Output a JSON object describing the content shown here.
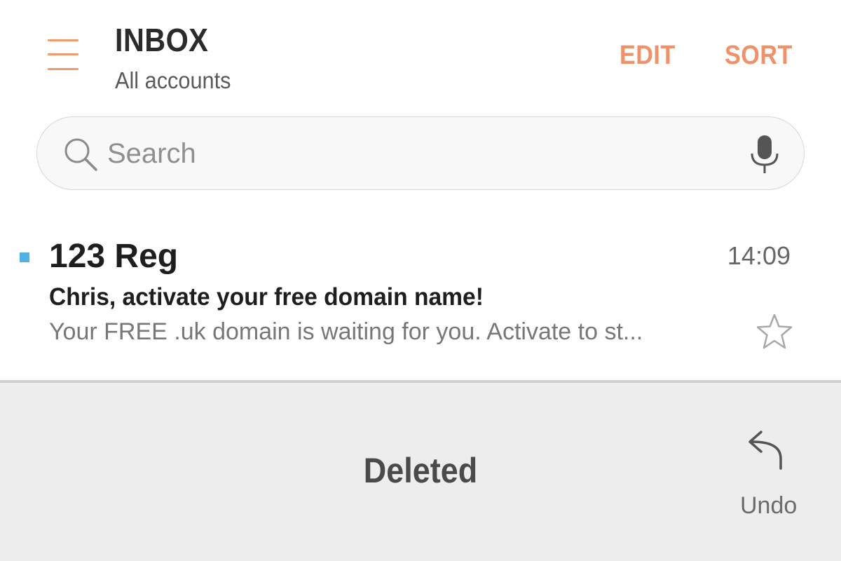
{
  "header": {
    "title": "INBOX",
    "subtitle": "All accounts",
    "edit_label": "EDIT",
    "sort_label": "SORT",
    "accent_color": "#f0916a"
  },
  "search": {
    "placeholder": "Search",
    "value": ""
  },
  "icons": {
    "menu": "menu-icon",
    "search": "search-icon",
    "mic": "microphone-icon",
    "star": "star-outline-icon",
    "undo": "undo-arrow-icon"
  },
  "emails": [
    {
      "sender": "123 Reg",
      "time": "14:09",
      "subject": "Chris, activate your free domain name!",
      "preview": "Your FREE .uk domain is waiting for you. Activate to st...",
      "unread": true,
      "starred": false,
      "unread_color": "#4fb1e4"
    }
  ],
  "snackbar": {
    "message": "Deleted",
    "action_label": "Undo"
  }
}
